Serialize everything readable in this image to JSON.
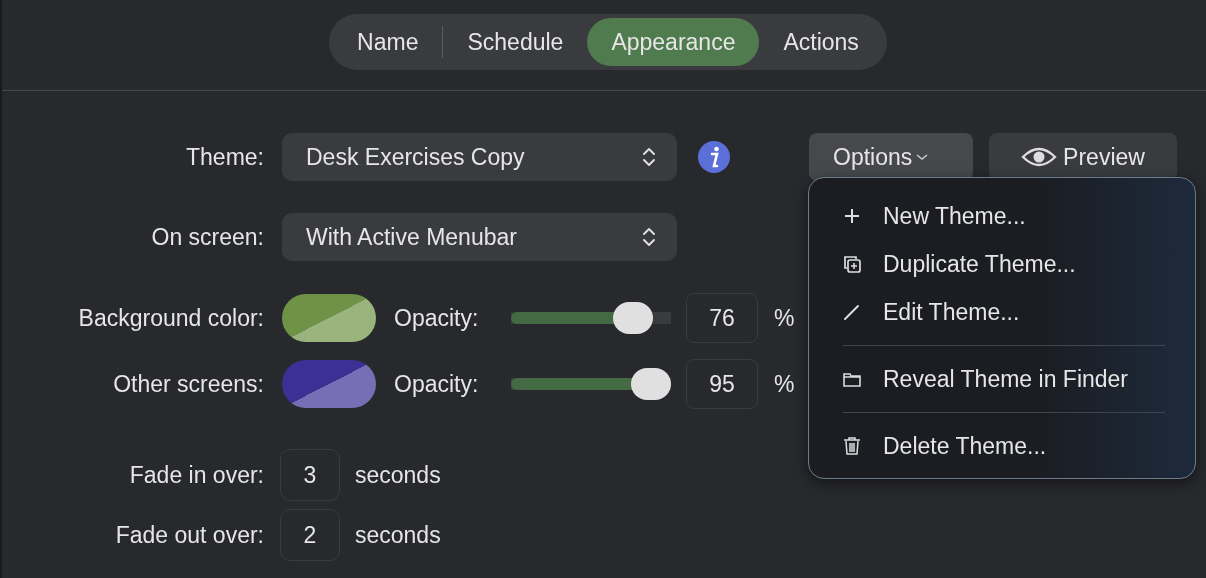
{
  "tabs": [
    {
      "label": "Name",
      "selected": false
    },
    {
      "label": "Schedule",
      "selected": false
    },
    {
      "label": "Appearance",
      "selected": true
    },
    {
      "label": "Actions",
      "selected": false
    }
  ],
  "theme": {
    "label": "Theme:",
    "value": "Desk Exercises Copy"
  },
  "options_button": {
    "label": "Options",
    "expanded": true
  },
  "preview_button": {
    "label": "Preview"
  },
  "on_screen": {
    "label": "On screen:",
    "value": "With Active Menubar"
  },
  "color_rows": [
    {
      "label": "Background color:",
      "color": "#6f9346",
      "opacity_label": "Opacity:",
      "level": 0.76,
      "value": "76",
      "unit": "%"
    },
    {
      "label": "Other screens:",
      "color": "#3e2f95",
      "opacity_label": "Opacity:",
      "level": 0.95,
      "value": "95",
      "unit": "%"
    }
  ],
  "fade_rows": [
    {
      "label": "Fade in over:",
      "value": "3",
      "unit": "seconds"
    },
    {
      "label": "Fade out over:",
      "value": "2",
      "unit": "seconds"
    }
  ],
  "options_menu": {
    "groups": [
      [
        "New Theme...",
        "Duplicate Theme...",
        "Edit Theme..."
      ],
      [
        "Reveal Theme in Finder"
      ],
      [
        "Delete Theme..."
      ]
    ]
  }
}
